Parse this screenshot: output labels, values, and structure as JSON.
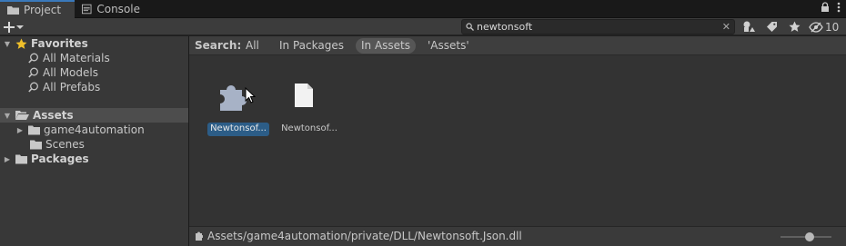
{
  "tabs": [
    {
      "label": "Project",
      "icon": "folder-icon",
      "active": true
    },
    {
      "label": "Console",
      "icon": "console-icon",
      "active": false
    }
  ],
  "toolbar": {
    "search_value": "newtonsoft",
    "hidden_count": "10"
  },
  "sidebar": {
    "favorites": {
      "label": "Favorites",
      "items": [
        "All Materials",
        "All Models",
        "All Prefabs"
      ]
    },
    "assets": {
      "label": "Assets",
      "children": [
        "game4automation",
        "Scenes"
      ]
    },
    "packages": {
      "label": "Packages"
    }
  },
  "filter": {
    "label": "Search:",
    "options": [
      "All",
      "In Packages",
      "In Assets",
      "'Assets'"
    ],
    "active": "In Assets"
  },
  "assets": [
    {
      "name": "Newtonsoft.Json.dll",
      "short": "Newtonsof...",
      "icon": "puzzle-icon",
      "selected": true
    },
    {
      "name": "Newtonsoft.Json.xml",
      "short": "Newtonsof...",
      "icon": "document-icon",
      "selected": false
    }
  ],
  "status": {
    "path": "Assets/game4automation/private/DLL/Newtonsoft.Json.dll",
    "zoom": 0.58
  },
  "colors": {
    "accent": "#3a79bb",
    "selection": "#2c5d87",
    "star": "#f0c02a"
  }
}
